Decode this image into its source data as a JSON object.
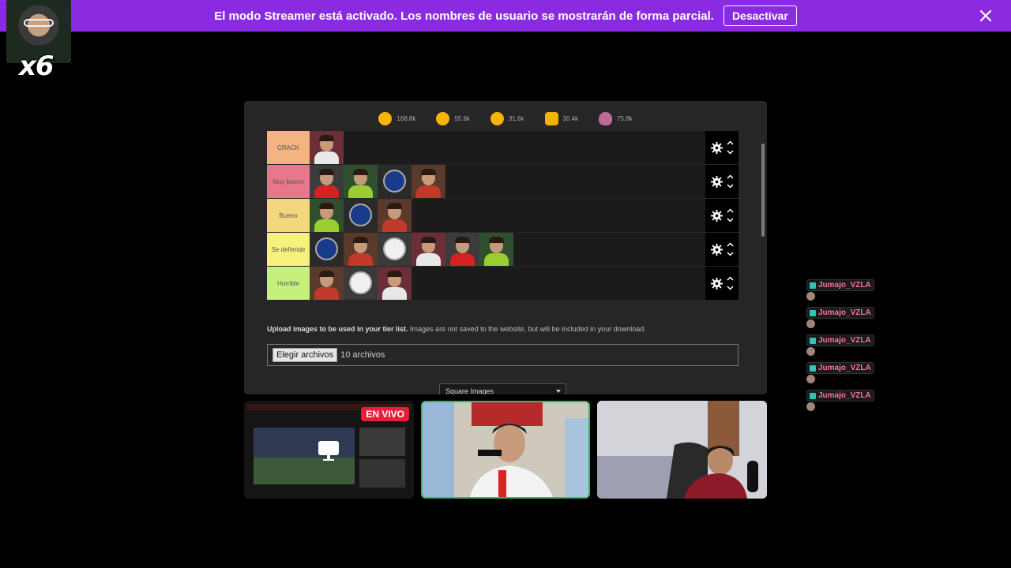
{
  "banner": {
    "message": "El modo Streamer está activado. Los nombres de usuario se mostrarán de forma parcial.",
    "button_label": "Desactivar"
  },
  "cam_overlay": {
    "multiplier": "x6"
  },
  "reactions": [
    {
      "icon": "grinning-face-icon",
      "count": "168.8k",
      "color": "#f7b500"
    },
    {
      "icon": "heart-eyes-icon",
      "count": "55.6k",
      "color": "#f7b500"
    },
    {
      "icon": "laughing-face-icon",
      "count": "31.6k",
      "color": "#f7b500"
    },
    {
      "icon": "praying-hands-icon",
      "count": "30.4k",
      "color": "#f0b400"
    },
    {
      "icon": "poop-icon",
      "count": "75.8k",
      "color": "#c06a9a"
    }
  ],
  "tiers": [
    {
      "label": "CRACK",
      "color": "#f3b47f",
      "items": 1
    },
    {
      "label": "Muy bueno",
      "color": "#e8778c",
      "items": 4
    },
    {
      "label": "Bueno",
      "color": "#f3d77c",
      "items": 3
    },
    {
      "label": "Se defiende",
      "color": "#f6f07c",
      "items": 6
    },
    {
      "label": "Horrible",
      "color": "#c5f07c",
      "items": 3
    }
  ],
  "upload": {
    "bold": "Upload images to be used in your tier list.",
    "rest": " Images are not saved to the website, but will be included in your download.",
    "file_button": "Elegir archivos",
    "file_status": "10 archivos"
  },
  "image_shape_select": "Square Images",
  "live_badge": "EN VIVO",
  "notifications": [
    "Jumajo_VZLA",
    "Jumajo_VZLA",
    "Jumajo_VZLA",
    "Jumajo_VZLA",
    "Jumajo_VZLA"
  ]
}
